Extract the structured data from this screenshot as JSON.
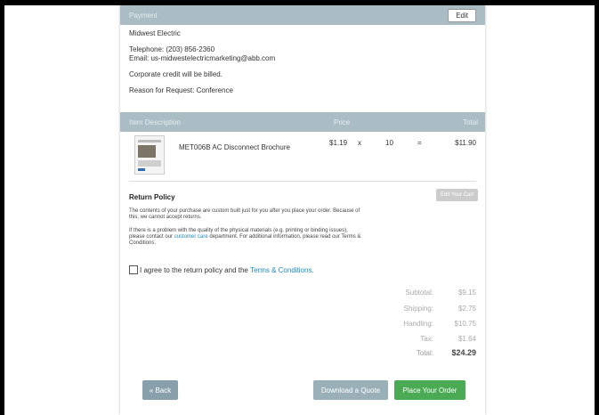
{
  "payment": {
    "header": "Payment",
    "edit_label": "Edit",
    "company": "Midwest Electric",
    "telephone": "Telephone: (203) 856-2360",
    "email": "Email: us-midwestelectricmarketing@abb.com",
    "billing_note": "Corporate credit will be billed.",
    "reason": "Reason for Request: Conference"
  },
  "items": {
    "headers": {
      "description": "Item Description",
      "price": "Price",
      "total": "Total"
    },
    "rows": [
      {
        "name": "MET006B AC Disconnect Brochure",
        "price": "$1.19",
        "times": "x",
        "qty": "10",
        "equals": "=",
        "total": "$11.90"
      }
    ]
  },
  "return_policy": {
    "title": "Return Policy",
    "edit_cart_label": "Edit Your Cart",
    "para1": "The contents of your purchase are custom built just for you after you place your order. Because of this, we cannot accept returns.",
    "para2_before": "If there is a problem with the quality of the physical materials (e.g. printing or binding issues), please contact our",
    "para2_link": "customer care",
    "para2_after": "department. For additional information, please read our Terms & Conditions."
  },
  "agreement": {
    "text": "I agree to the return policy and the",
    "link": "Terms & Conditions."
  },
  "totals": {
    "subtotal_label": "Subtotal:",
    "subtotal": "$9.15",
    "shipping_label": "Shipping:",
    "shipping": "$2.75",
    "handling_label": "Handling:",
    "handling": "$10.75",
    "tax_label": "Tax:",
    "tax": "$1.64",
    "total_label": "Total:",
    "total": "$24.29"
  },
  "actions": {
    "back": "« Back",
    "download_quote": "Download a Quote",
    "place_order": "Place Your Order"
  },
  "colors": {
    "header_bar": "#aabcc4",
    "accent_link": "#1b8bc6",
    "place_order": "#4bab54"
  }
}
